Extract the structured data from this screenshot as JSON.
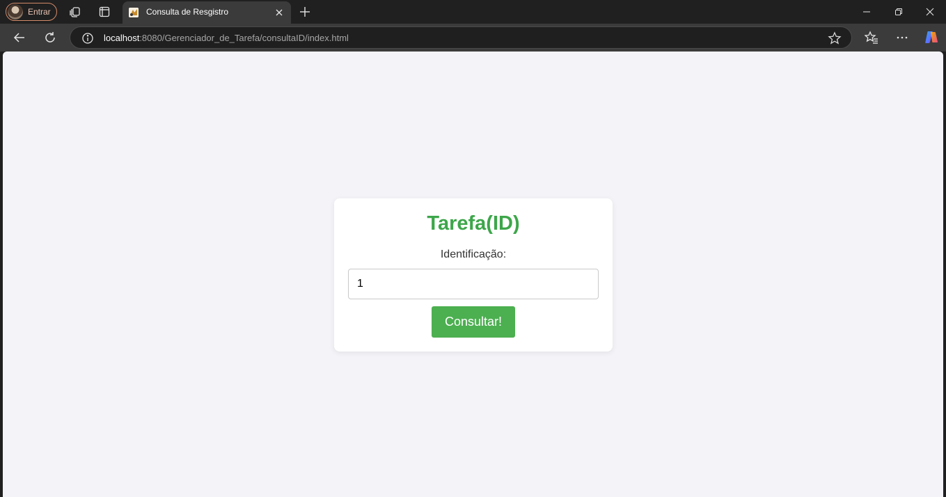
{
  "browser": {
    "profile_label": "Entrar",
    "tab": {
      "title": "Consulta de Resgistro"
    },
    "address": {
      "host": "localhost",
      "rest": ":8080/Gerenciador_de_Tarefa/consultaID/index.html"
    }
  },
  "page": {
    "title": "Tarefa(ID)",
    "field_label": "Identificação:",
    "id_value": "1",
    "submit_label": "Consultar!"
  },
  "colors": {
    "title_green": "#3da64a",
    "button_green": "#4caf50",
    "page_background": "#f4f4f8"
  }
}
